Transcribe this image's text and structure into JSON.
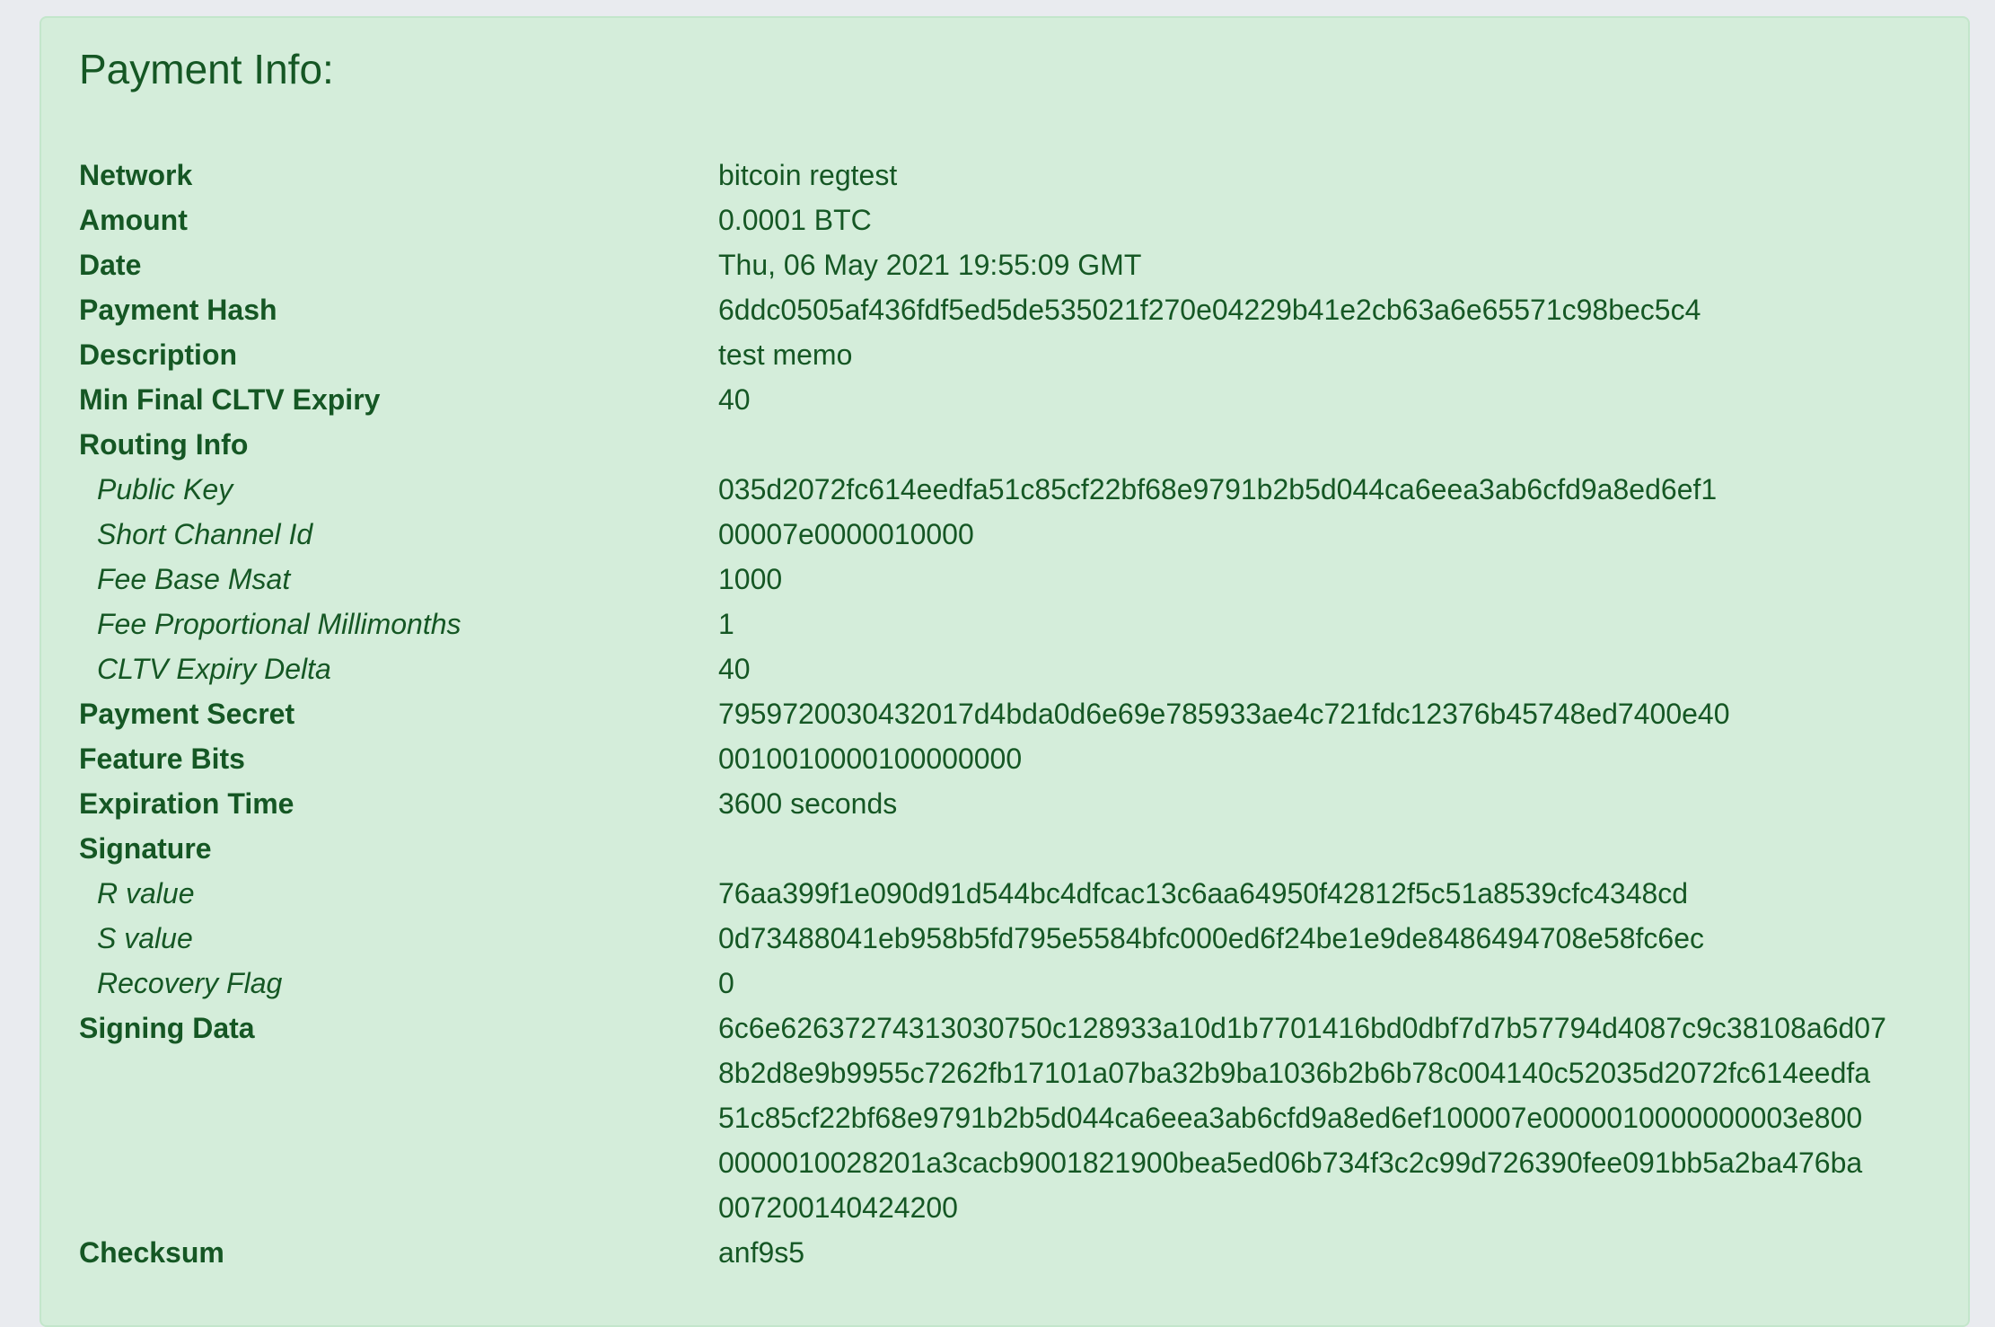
{
  "panel": {
    "title": "Payment Info:"
  },
  "rows": [
    {
      "label": "Network",
      "value": "bitcoin regtest",
      "sub": false
    },
    {
      "label": "Amount",
      "value": "0.0001 BTC",
      "sub": false
    },
    {
      "label": "Date",
      "value": "Thu, 06 May 2021 19:55:09 GMT",
      "sub": false
    },
    {
      "label": "Payment Hash",
      "value": "6ddc0505af436fdf5ed5de535021f270e04229b41e2cb63a6e65571c98bec5c4",
      "sub": false
    },
    {
      "label": "Description",
      "value": "test memo",
      "sub": false
    },
    {
      "label": "Min Final CLTV Expiry",
      "value": "40",
      "sub": false
    },
    {
      "label": "Routing Info",
      "value": "",
      "sub": false
    },
    {
      "label": "Public Key",
      "value": "035d2072fc614eedfa51c85cf22bf68e9791b2b5d044ca6eea3ab6cfd9a8ed6ef1",
      "sub": true
    },
    {
      "label": "Short Channel Id",
      "value": "00007e0000010000",
      "sub": true
    },
    {
      "label": "Fee Base Msat",
      "value": "1000",
      "sub": true
    },
    {
      "label": "Fee Proportional Millimonths",
      "value": "1",
      "sub": true
    },
    {
      "label": "CLTV Expiry Delta",
      "value": "40",
      "sub": true
    },
    {
      "label": "Payment Secret",
      "value": "7959720030432017d4bda0d6e69e785933ae4c721fdc12376b45748ed7400e40",
      "sub": false
    },
    {
      "label": "Feature Bits",
      "value": "0010010000100000000",
      "sub": false
    },
    {
      "label": "Expiration Time",
      "value": "3600 seconds",
      "sub": false
    },
    {
      "label": "Signature",
      "value": "",
      "sub": false
    },
    {
      "label": "R value",
      "value": "76aa399f1e090d91d544bc4dfcac13c6aa64950f42812f5c51a8539cfc4348cd",
      "sub": true
    },
    {
      "label": "S value",
      "value": "0d73488041eb958b5fd795e5584bfc000ed6f24be1e9de8486494708e58fc6ec",
      "sub": true
    },
    {
      "label": "Recovery Flag",
      "value": "0",
      "sub": true
    },
    {
      "label": "Signing Data",
      "value_lines": [
        "6c6e62637274313030750c128933a10d1b7701416bd0dbf7d7b57794d4087c9c38108a6d07",
        "8b2d8e9b9955c7262fb17101a07ba32b9ba1036b2b6b78c004140c52035d2072fc614eedfa",
        "51c85cf22bf68e9791b2b5d044ca6eea3ab6cfd9a8ed6ef100007e0000010000000003e800",
        "0000010028201a3cacb9001821900bea5ed06b734f3c2c99d726390fee091bb5a2ba476ba",
        "007200140424200"
      ],
      "sub": false
    },
    {
      "label": "Checksum",
      "value": "anf9s5",
      "sub": false
    }
  ],
  "colors": {
    "page_background": "#e9ebef",
    "panel_background": "#d4edda",
    "panel_border": "#c3e6cb",
    "text": "#155724"
  }
}
